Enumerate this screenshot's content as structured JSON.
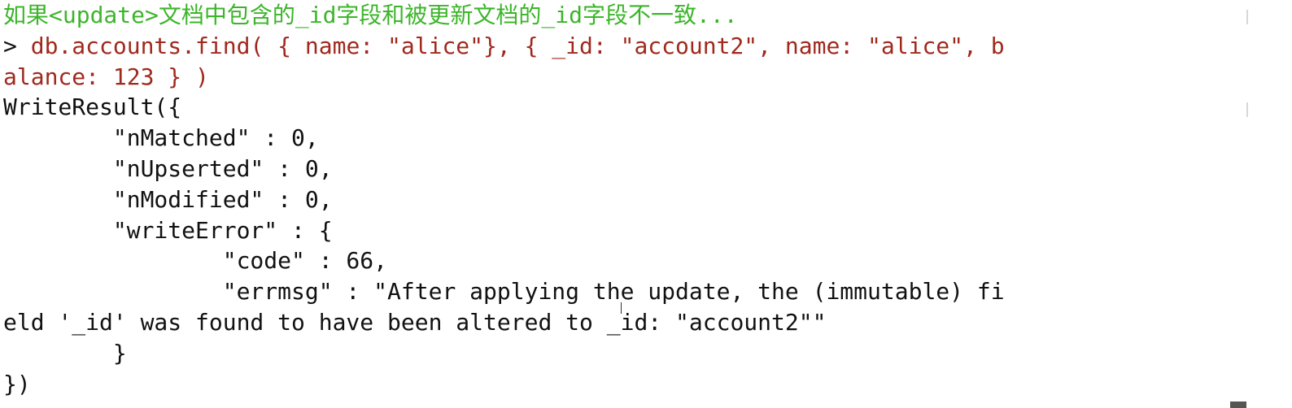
{
  "terminal": {
    "comment_line": "如果<update>文档中包含的_id字段和被更新文档的_id字段不一致...",
    "prompt_symbol": "> ",
    "command_line_1": "db.accounts.find( { name: \"alice\"}, { _id: \"account2\", name: \"alice\", b",
    "command_line_2": "alance: 123 } )",
    "output_lines": [
      "WriteResult({",
      "        \"nMatched\" : 0,",
      "        \"nUpserted\" : 0,",
      "        \"nModified\" : 0,",
      "        \"writeError\" : {",
      "                \"code\" : 66,",
      "                \"errmsg\" : \"After applying the update, the (immutable) fi",
      "eld '_id' was found to have been altered to _id: \"account2\"\"",
      "        }",
      "})"
    ]
  },
  "colors": {
    "comment": "#3cb52a",
    "command": "#a0291e",
    "output": "#111111",
    "background": "#ffffff"
  }
}
